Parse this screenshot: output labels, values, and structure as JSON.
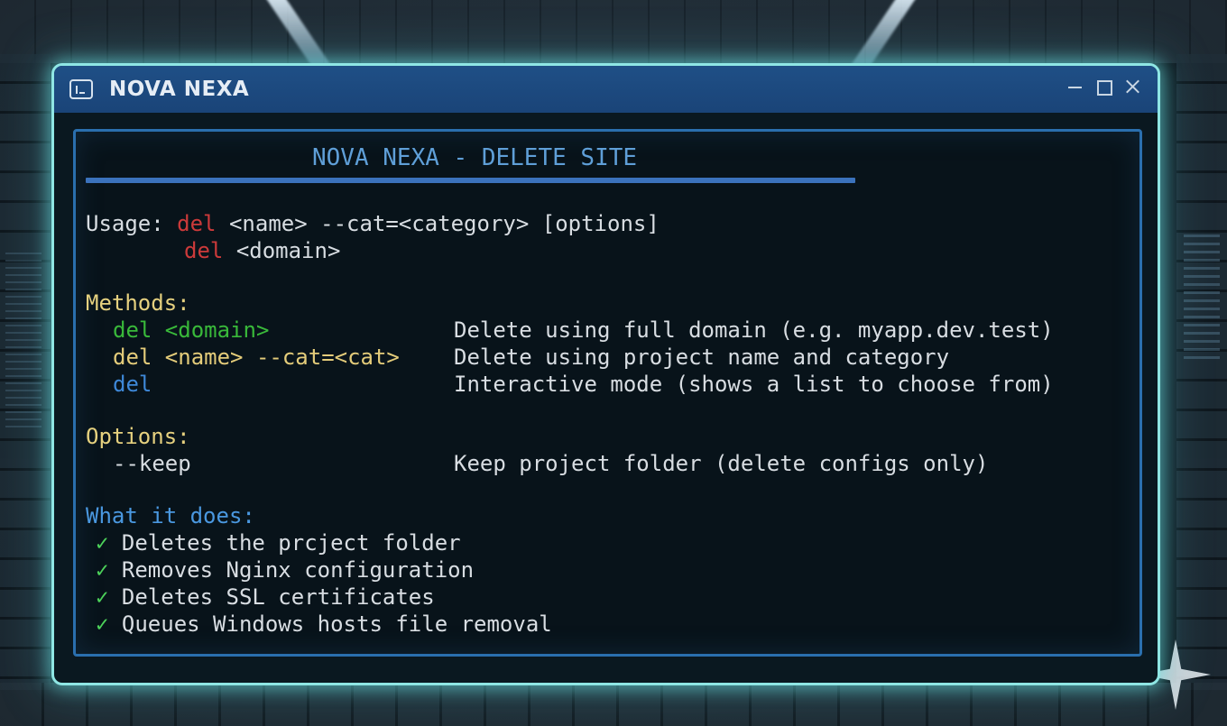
{
  "window": {
    "title": "NOVA NEXA"
  },
  "terminal": {
    "header": "NOVA NEXA - DELETE SITE",
    "usage": {
      "label": "Usage:",
      "line1_cmd": "del",
      "line1_args": "<name> --cat=<category> [options]",
      "line2_cmd": "del",
      "line2_args": "<domain>"
    },
    "methods": {
      "heading": "Methods:",
      "items": [
        {
          "syntax": "del <domain>",
          "description": "Delete using full domain (e.g. myapp.dev.test)",
          "color": "#39b93a"
        },
        {
          "syntax": "del <name> --cat=<cat>",
          "description": "Delete using project name and category",
          "color": "#e4cc7a"
        },
        {
          "syntax": "del",
          "description": "Interactive mode (shows a list to choose from)",
          "color": "#3e88d8"
        }
      ]
    },
    "options": {
      "heading": "Options:",
      "items": [
        {
          "flag": "--keep",
          "description": "Keep project folder (delete configs only)"
        }
      ]
    },
    "what_it_does": {
      "heading": "What it does:",
      "check": "✓",
      "items": [
        "Deletes the prcject folder",
        "Removes Nginx configuration",
        "Deletes SSL certificates",
        "Queues Windows hosts file removal"
      ]
    }
  }
}
